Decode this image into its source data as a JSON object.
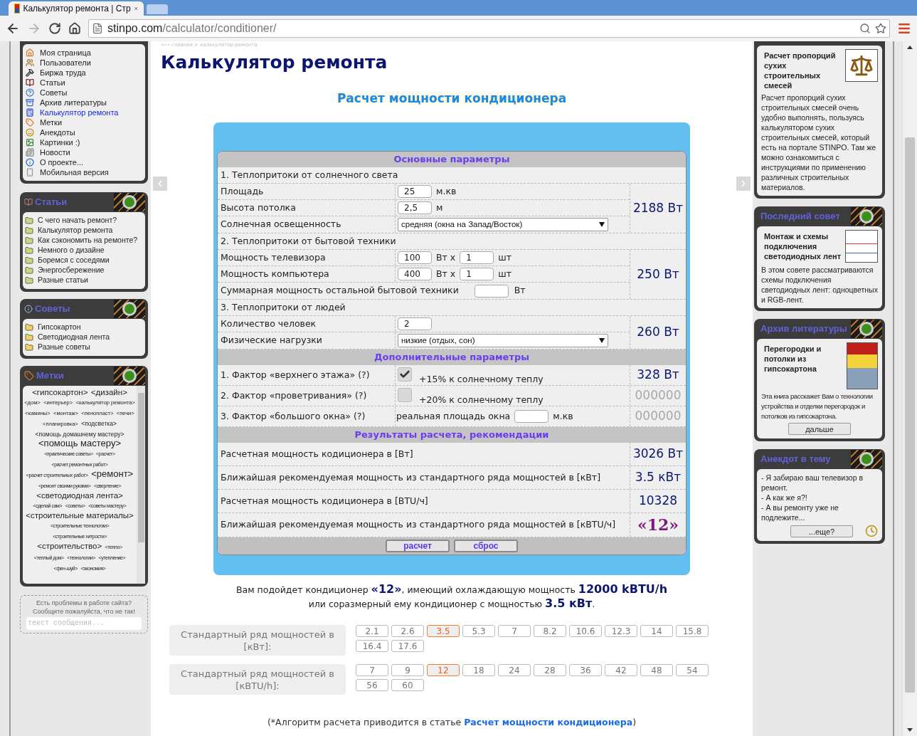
{
  "browser": {
    "tab_title": "Калькулятор ремонта | Стр",
    "url_host": "stinpo.com",
    "url_path": "/calculator/conditioner/"
  },
  "main_menu": {
    "items": [
      {
        "label": "Моя страница",
        "selected": false
      },
      {
        "label": "Пользователи",
        "selected": false
      },
      {
        "label": "Биржа труда",
        "selected": false
      },
      {
        "label": "Статьи",
        "selected": false
      },
      {
        "label": "Советы",
        "selected": false
      },
      {
        "label": "Архив литературы",
        "selected": false
      },
      {
        "label": "Калькулятор ремонта",
        "selected": true
      },
      {
        "label": "Метки",
        "selected": false
      },
      {
        "label": "Анекдоты",
        "selected": false
      },
      {
        "label": "Картинки :)",
        "selected": false
      },
      {
        "label": "Новости",
        "selected": false
      },
      {
        "label": "О проекте...",
        "selected": false
      },
      {
        "label": "Мобильная версия",
        "selected": false
      }
    ]
  },
  "articles": {
    "header": "Статьи",
    "items": [
      "С чего начать ремонт?",
      "Калькулятор ремонта",
      "Как сэкономить на ремонте?",
      "Немного о дизайне",
      "Боремся с соседями",
      "Энергосбережение",
      "Разные статьи"
    ]
  },
  "tips": {
    "header": "Советы",
    "items": [
      "Гипсокартон",
      "Светодиодная лента",
      "Разные советы"
    ]
  },
  "tags": {
    "header": "Метки",
    "items": [
      {
        "label": "<гипсокартон>",
        "kind": "m"
      },
      {
        "label": "<дизайн>",
        "kind": "m"
      },
      {
        "label": "<дом>",
        "kind": "s"
      },
      {
        "label": "<интерьер>",
        "kind": "s"
      },
      {
        "label": "<калькулятор ремонта>",
        "kind": "s"
      },
      {
        "label": "<камины>",
        "kind": "s"
      },
      {
        "label": "<монтаж>",
        "kind": "s"
      },
      {
        "label": "<пенопласт>",
        "kind": "s"
      },
      {
        "label": "<печи>",
        "kind": "s"
      },
      {
        "label": "<планировка>",
        "kind": "s"
      },
      {
        "label": "<подсветка>",
        "kind": "sm"
      },
      {
        "label": "<помощь домашнему мастеру>",
        "kind": "sm"
      },
      {
        "label": "<помощь мастеру>",
        "kind": "l"
      },
      {
        "label": "<практические советы>",
        "kind": "xs"
      },
      {
        "label": "<расчет>",
        "kind": "xs"
      },
      {
        "label": "<расчет ремонтных работ>",
        "kind": "xs"
      },
      {
        "label": "<расчет строительных работ>",
        "kind": "xs"
      },
      {
        "label": "<ремонт>",
        "kind": "l"
      },
      {
        "label": "<ремонт своими руками>",
        "kind": "xs"
      },
      {
        "label": "<сверление>",
        "kind": "xs"
      },
      {
        "label": "<светодиодная лента>",
        "kind": "m"
      },
      {
        "label": "<сделай сам>",
        "kind": "xs"
      },
      {
        "label": "<советы>",
        "kind": "xs"
      },
      {
        "label": "<советы мастеру>",
        "kind": "xs"
      },
      {
        "label": "<строительные материалы>",
        "kind": "m"
      },
      {
        "label": "<строительные технологии>",
        "kind": "xs"
      },
      {
        "label": "<строительные хитрости>",
        "kind": "xs"
      },
      {
        "label": "<строительство>",
        "kind": "m"
      },
      {
        "label": "<тепло>",
        "kind": "xs"
      },
      {
        "label": "<теплый дом>",
        "kind": "xs"
      },
      {
        "label": "<технологии>",
        "kind": "xs"
      },
      {
        "label": "<утепление>",
        "kind": "xs"
      },
      {
        "label": "<фен-шуй>",
        "kind": "xs"
      },
      {
        "label": "<экономия>",
        "kind": "xs"
      }
    ]
  },
  "feedback": {
    "lines": [
      "Есть проблемы в работе сайта?",
      "Сообщите пожалуйста, что не так!"
    ],
    "placeholder": "текст сообщения..."
  },
  "breadcrumb": "»»» главная > калькулятор ремонта",
  "title": "Калькулятор ремонта",
  "subtitle": "Расчет мощности кондиционера",
  "sections": [
    {
      "title": "Основные параметры",
      "groups": [
        {
          "heading": "1. Теплопритоки от солнечного света",
          "rows": [
            {
              "kind": "input",
              "label": "Площадь",
              "value": "25",
              "unit": "м.кв"
            },
            {
              "kind": "input",
              "label": "Высота потолка",
              "value": "2,5",
              "unit": "м"
            },
            {
              "kind": "select",
              "label": "Солнечная освещенность",
              "value": "средняя (окна на Запад/Восток)"
            }
          ],
          "result": {
            "text": "2188 Вт"
          }
        },
        {
          "heading": "2. Теплопритоки от бытовой техники",
          "rows": [
            {
              "kind": "double",
              "label": "Мощность телевизора",
              "value": "100",
              "unit": "Вт x",
              "value2": "1",
              "unit2": "шт"
            },
            {
              "kind": "double",
              "label": "Мощность компьютера",
              "value": "400",
              "unit": "Вт x",
              "value2": "1",
              "unit2": "шт"
            },
            {
              "kind": "wide",
              "label": "Суммарная мощность остальной бытовой техники",
              "unit": "Вт"
            }
          ],
          "result": {
            "text": "250 Вт"
          }
        },
        {
          "heading": "3. Теплопритоки от людей",
          "rows": [
            {
              "kind": "input",
              "label": "Количество человек",
              "value": "2"
            },
            {
              "kind": "select",
              "label": "Физические нагрузки",
              "value": "низкие (отдых, сон)"
            }
          ],
          "result": {
            "text": "260 Вт"
          }
        }
      ]
    },
    {
      "title": "Дополнительные параметры",
      "groups": [
        {
          "rows": [
            {
              "kind": "checkbox",
              "label": "1. Фактор «верхнего этажа» (?)",
              "checked": true,
              "note": "+15% к солнечному теплу"
            }
          ],
          "result": {
            "text": "328 Вт",
            "active": true
          }
        },
        {
          "rows": [
            {
              "kind": "checkbox",
              "label": "2. Фактор «проветривания» (?)",
              "checked": false,
              "note": "+20% к солнечному теплу"
            }
          ],
          "result": {
            "text": "000000",
            "active": false
          }
        },
        {
          "rows": [
            {
              "kind": "area",
              "label": "3. Фактор «большого окна» (?)",
              "prefix": "реальная площадь окна",
              "unit": "м.кв"
            }
          ],
          "result": {
            "text": "000000",
            "active": false
          }
        }
      ]
    },
    {
      "title": "Результаты расчета, рекомендации",
      "groups": [
        {
          "rows": [
            {
              "kind": "text",
              "label": "Расчетная мощность кодиционера в [Вт]"
            }
          ],
          "result": {
            "text": "3026 Вт",
            "kind": "value"
          }
        },
        {
          "rows": [
            {
              "kind": "text",
              "label": "Ближайшая рекомендуемая мощность из стандартного ряда мощностей в [кВт]"
            }
          ],
          "result": {
            "text": "3.5 кВт",
            "kind": "value"
          }
        },
        {
          "rows": [
            {
              "kind": "text",
              "label": "Расчетная мощность кодиционера в [BTU/ч]"
            }
          ],
          "result": {
            "text": "10328",
            "kind": "value"
          }
        },
        {
          "rows": [
            {
              "kind": "text",
              "label": "Ближайшая рекомендуемая мощность из стандартного ряда мощностей в [кBTU/ч]"
            }
          ],
          "result": {
            "text": "«12»",
            "kind": "highlight"
          }
        }
      ]
    }
  ],
  "buttons": [
    "расчет",
    "сброс"
  ],
  "summary": [
    "Вам подойдет кондиционер **«12»**, имеющий охлаждающую мощность **12000 kBTU/h**",
    "или соразмерный ему кондиционер с мощностью **3.5 кВт**."
  ],
  "standard_rows": [
    {
      "label": "Стандартный ряд мощностей в [кВт]:",
      "values": [
        {
          "text": "2.1",
          "selected": false
        },
        {
          "text": "2.6",
          "selected": false
        },
        {
          "text": "3.5",
          "selected": true
        },
        {
          "text": "5.3",
          "selected": false
        },
        {
          "text": "7",
          "selected": false
        },
        {
          "text": "8.2",
          "selected": false
        },
        {
          "text": "10.6",
          "selected": false
        },
        {
          "text": "12.3",
          "selected": false
        },
        {
          "text": "14",
          "selected": false
        },
        {
          "text": "15.8",
          "selected": false
        },
        {
          "text": "16.4",
          "selected": false
        },
        {
          "text": "17.6",
          "selected": false
        }
      ]
    },
    {
      "label": "Стандартный ряд мощностей в [кBTU/h]:",
      "values": [
        {
          "text": "7",
          "selected": false
        },
        {
          "text": "9",
          "selected": false
        },
        {
          "text": "12",
          "selected": true
        },
        {
          "text": "18",
          "selected": false
        },
        {
          "text": "24",
          "selected": false
        },
        {
          "text": "28",
          "selected": false
        },
        {
          "text": "36",
          "selected": false
        },
        {
          "text": "42",
          "selected": false
        },
        {
          "text": "48",
          "selected": false
        },
        {
          "text": "54",
          "selected": false
        },
        {
          "text": "56",
          "selected": false
        },
        {
          "text": "60",
          "selected": false
        }
      ]
    }
  ],
  "note": {
    "before": "(*Алгоритм расчета приводится в статье ",
    "link": "Расчет мощности кондиционера",
    "after": ")"
  },
  "right_panels": [
    {
      "kind": "article",
      "title": "Расчет пропорций сухих строительных смесей",
      "text": "Расчет пропорций сухих строительных смесей очень удобно выполнять, пользуясь калькулятором сухих строительных смесей, который есть на портале STINPO. Там же можно ознакомиться с инструкциями по применению различных строительных материалов."
    },
    {
      "kind": "tip",
      "header": "Последний совет",
      "title": "Монтаж и схемы подключения светодиодных лент",
      "text": "В этом совете рассматриваются схемы подключения светодиодных лент: одноцветных и RGB-лент."
    },
    {
      "kind": "book",
      "header": "Архив литературы",
      "title": "Перегородки и потолки из гипсокартона",
      "text": "Эта книга расскажет Вам о технологии устройства и отделки перегородок и потолков из гипсокартона.",
      "button": "дальше"
    },
    {
      "kind": "joke",
      "header": "Анекдот в тему",
      "lines": [
        "- Я забираю ваш телевизор в ремонт.",
        "- А как же я?!",
        "- А вы ремонту уже не подлежите..."
      ],
      "button": "...еще?"
    }
  ]
}
